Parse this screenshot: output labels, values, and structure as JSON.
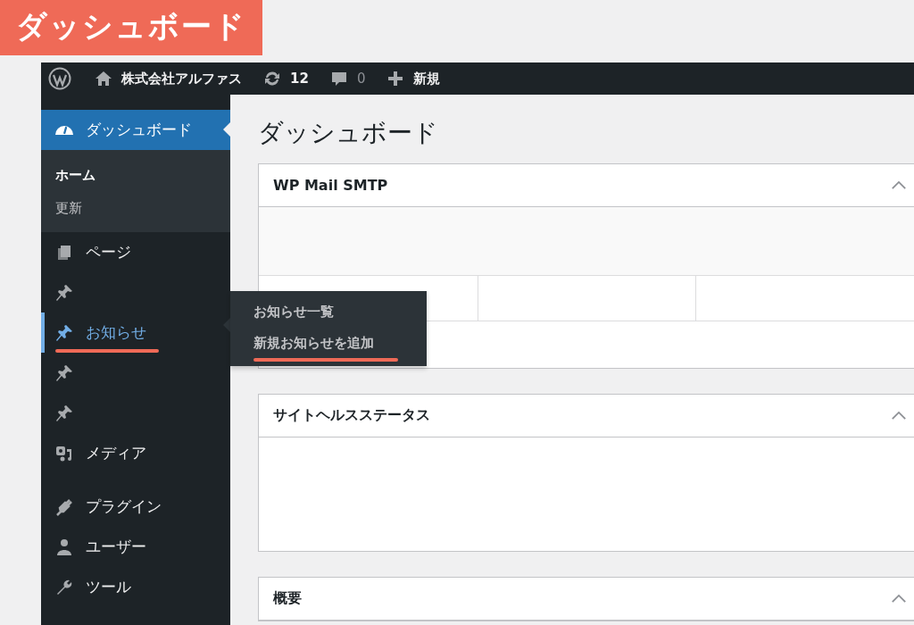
{
  "annotation_label": "ダッシュボード",
  "admin_bar": {
    "site_name": "株式会社アルファス",
    "updates": "12",
    "comments": "0",
    "new": "新規"
  },
  "sidebar": {
    "items": [
      {
        "kind": "dashboard",
        "label": "ダッシュボード",
        "selected": true,
        "highlighted": false,
        "underlined": false,
        "submenu": [
          {
            "label": "ホーム",
            "selected": true
          },
          {
            "label": "更新",
            "selected": false
          }
        ]
      },
      {
        "kind": "pages",
        "label": "ページ",
        "selected": false,
        "highlighted": false,
        "underlined": false
      },
      {
        "kind": "pin",
        "selected": false,
        "highlighted": false,
        "underlined": false
      },
      {
        "kind": "pin",
        "label": "お知らせ",
        "selected": false,
        "highlighted": true,
        "underlined": true,
        "flyout": [
          {
            "label": "お知らせ一覧",
            "underlined": false
          },
          {
            "label": "新規お知らせを追加",
            "underlined": true
          }
        ]
      },
      {
        "kind": "pin",
        "selected": false,
        "highlighted": false,
        "underlined": false
      },
      {
        "kind": "pin",
        "selected": false,
        "highlighted": false,
        "underlined": false
      },
      {
        "kind": "media",
        "label": "メディア",
        "selected": false,
        "highlighted": false,
        "underlined": false
      },
      {
        "kind": "separator"
      },
      {
        "kind": "plugin",
        "label": "プラグイン",
        "selected": false,
        "highlighted": false,
        "underlined": false
      },
      {
        "kind": "user",
        "label": "ユーザー",
        "selected": false,
        "highlighted": false,
        "underlined": false
      },
      {
        "kind": "tool",
        "label": "ツール",
        "selected": false,
        "highlighted": false,
        "underlined": false
      }
    ]
  },
  "page_title": "ダッシュボード",
  "panels": [
    {
      "kind": "smtp",
      "title": "WP Mail SMTP",
      "expanded": true
    },
    {
      "kind": "plain",
      "title": "サイトヘルスステータス",
      "expanded": true
    },
    {
      "kind": "cut",
      "title": "概要",
      "expanded": true
    }
  ]
}
